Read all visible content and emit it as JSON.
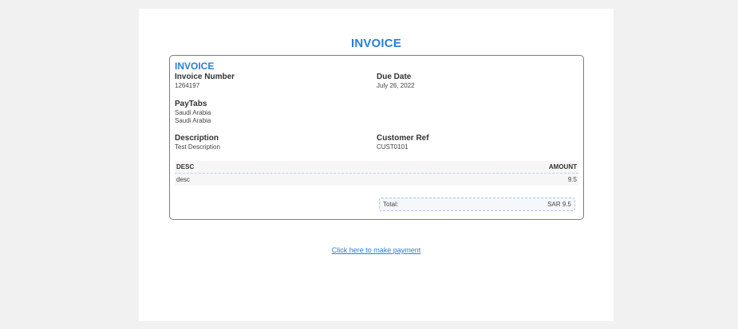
{
  "document": {
    "title": "INVOICE"
  },
  "card": {
    "heading": "INVOICE",
    "invoice_number": {
      "label": "Invoice Number",
      "value": "1264197"
    },
    "due_date": {
      "label": "Due Date",
      "value": "July 26, 2022"
    },
    "merchant": {
      "label": "PayTabs",
      "line1": "Saudi Arabia",
      "line2": "Saudi Arabia"
    },
    "description": {
      "label": "Description",
      "value": "Test Description"
    },
    "customer_ref": {
      "label": "Customer Ref",
      "value": "CUST0101"
    }
  },
  "items": {
    "columns": [
      "DESC",
      "AMOUNT"
    ],
    "rows": [
      {
        "desc": "desc",
        "amount": "9.5"
      }
    ]
  },
  "total": {
    "label": "Total:",
    "value": "SAR 9.5"
  },
  "payment_link": {
    "label": "Click here to make payment"
  }
}
